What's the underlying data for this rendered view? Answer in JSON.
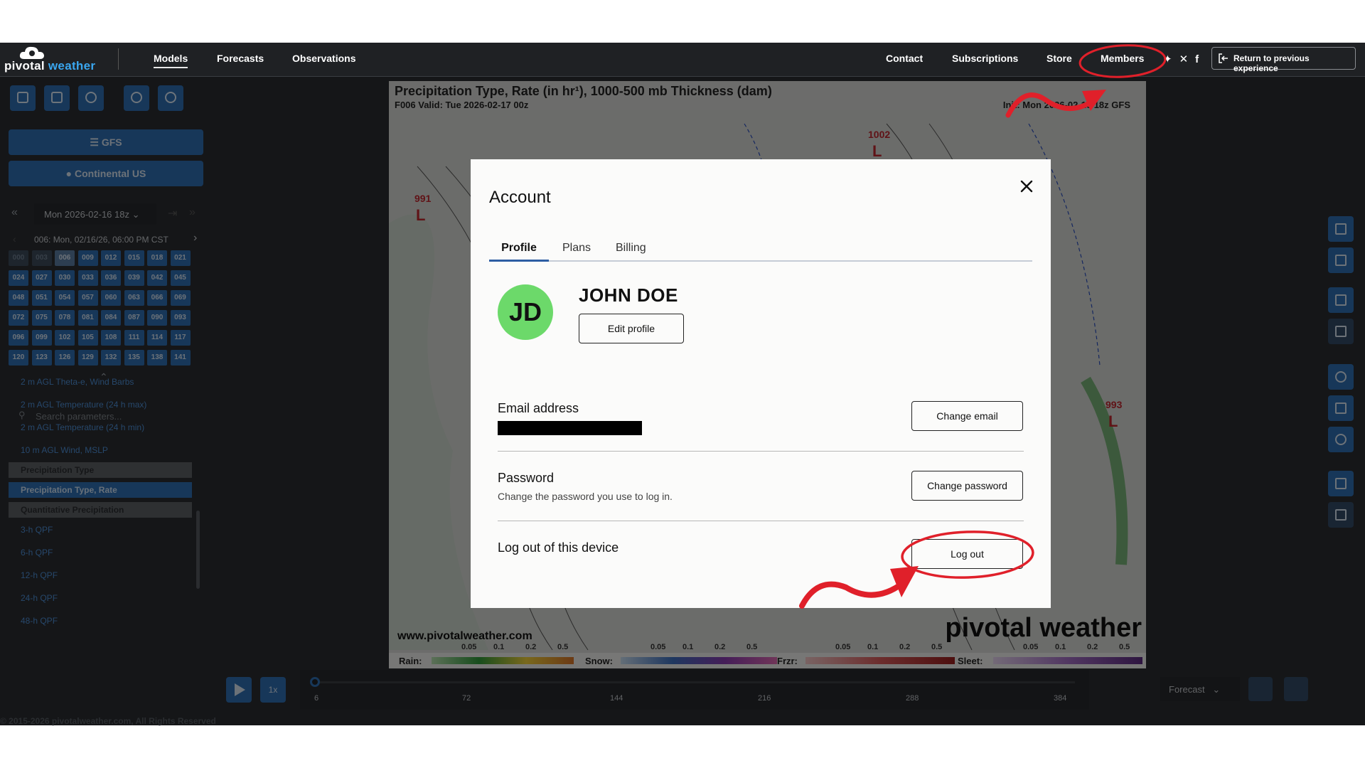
{
  "nav": {
    "logo_text_a": "pivotal",
    "logo_text_b": " weather",
    "links": [
      "Models",
      "Forecasts",
      "Observations"
    ],
    "right_links": [
      "Contact",
      "Subscriptions",
      "Store",
      "Members"
    ],
    "return_label": "Return to previous experience",
    "social_icons": [
      "bluesky-icon",
      "x-icon",
      "facebook-icon"
    ]
  },
  "sidebar": {
    "model_button": "GFS",
    "region_button": "Continental US",
    "run_select": "Mon 2026-02-16 18z",
    "forecast_hour_label": "006: Mon, 02/16/26, 06:00 PM CST",
    "hours": [
      "000",
      "003",
      "006",
      "009",
      "012",
      "015",
      "018",
      "021",
      "024",
      "027",
      "030",
      "033",
      "036",
      "039",
      "042",
      "045",
      "048",
      "051",
      "054",
      "057",
      "060",
      "063",
      "066",
      "069",
      "072",
      "075",
      "078",
      "081",
      "084",
      "087",
      "090",
      "093",
      "096",
      "099",
      "102",
      "105",
      "108",
      "111",
      "114",
      "117",
      "120",
      "123",
      "126",
      "129",
      "132",
      "135",
      "138",
      "141"
    ],
    "selected_hour": "006",
    "search_placeholder": "Search parameters...",
    "params": [
      {
        "label": "2 m AGL Theta-e, Wind Barbs",
        "kind": "item"
      },
      {
        "label": "2 m AGL Temperature (24 h max)",
        "kind": "item"
      },
      {
        "label": "2 m AGL Temperature (24 h min)",
        "kind": "item"
      },
      {
        "label": "10 m AGL Wind, MSLP",
        "kind": "item"
      },
      {
        "label": "Precipitation Type",
        "kind": "header"
      },
      {
        "label": "Precipitation Type, Rate",
        "kind": "active"
      },
      {
        "label": "Quantitative Precipitation",
        "kind": "header"
      },
      {
        "label": "3-h QPF",
        "kind": "item"
      },
      {
        "label": "6-h QPF",
        "kind": "item"
      },
      {
        "label": "12-h QPF",
        "kind": "item"
      },
      {
        "label": "24-h QPF",
        "kind": "item"
      },
      {
        "label": "48-h QPF",
        "kind": "item"
      }
    ]
  },
  "map": {
    "title": "Precipitation Type, Rate (in hr¹), 1000-500 mb Thickness (dam)",
    "valid": "F006 Valid: Tue 2026-02-17 00z",
    "init": "Init: Mon 2026-02-16 18z GFS",
    "url": "www.pivotalweather.com",
    "brand": "pivotal weather",
    "legend": {
      "rain": "Rain:",
      "snow": "Snow:",
      "frzr": "Frzr:",
      "sleet": "Sleet:",
      "ticks": [
        "0.05",
        "0.1",
        "0.2",
        "0.5"
      ]
    }
  },
  "playbar": {
    "speed": "1x",
    "ticks": [
      "6",
      "72",
      "144",
      "216",
      "288",
      "384"
    ],
    "forecast_select": "Forecast"
  },
  "footer": "© 2015-2026 pivotalweather.com, All Rights Reserved",
  "modal": {
    "title": "Account",
    "tabs": [
      "Profile",
      "Plans",
      "Billing"
    ],
    "avatar_initials": "JD",
    "user_name": "JOHN DOE",
    "edit_profile": "Edit profile",
    "email_label": "Email address",
    "change_email": "Change email",
    "password_label": "Password",
    "password_sub": "Change the password you use to log in.",
    "change_password": "Change password",
    "logout_label": "Log out of this device",
    "logout_button": "Log out"
  },
  "colors": {
    "nav_bg": "#1f2124",
    "accent": "#2f6fb3",
    "avatar": "#6cd96a",
    "annotation": "#e0202a"
  }
}
